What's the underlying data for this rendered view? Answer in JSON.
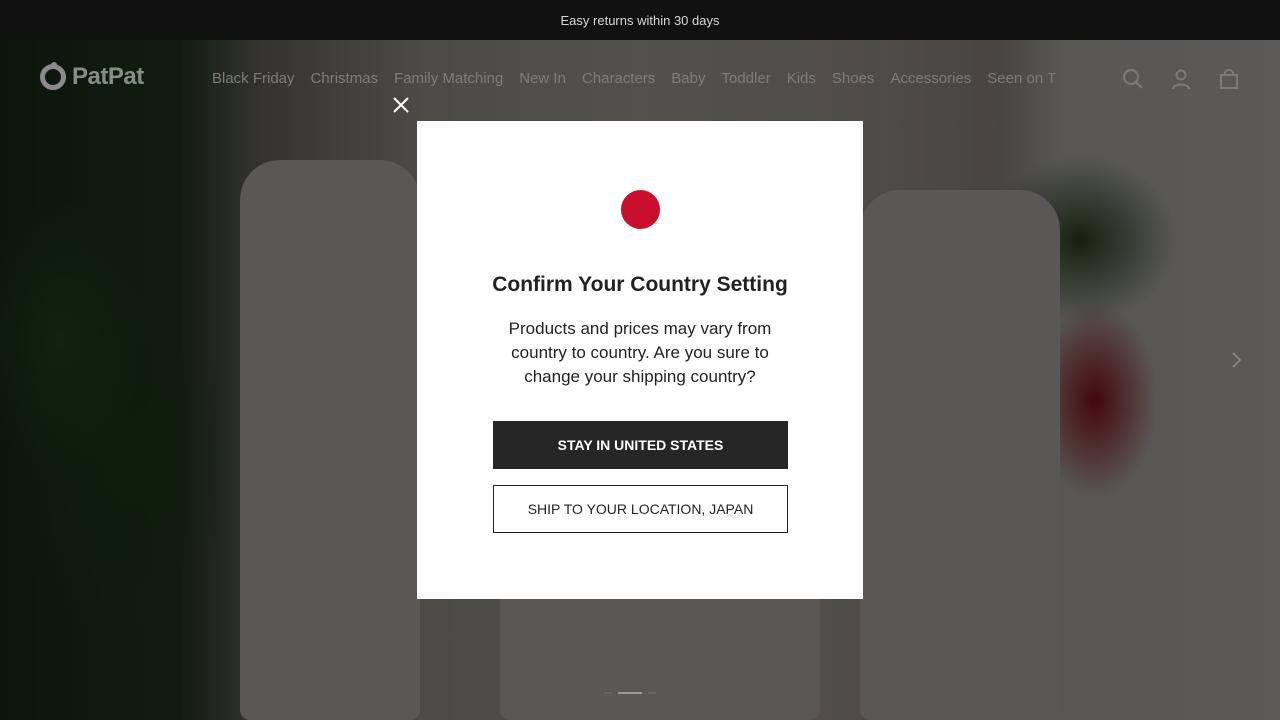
{
  "announcement": "Easy returns within 30 days",
  "brand": {
    "name": "PatPat"
  },
  "nav": {
    "items": [
      "Black Friday",
      "Christmas",
      "Family Matching",
      "New In",
      "Characters",
      "Baby",
      "Toddler",
      "Kids",
      "Shoes",
      "Accessories",
      "Seen on T"
    ],
    "icons": [
      "search-icon",
      "account-icon",
      "bag-icon"
    ]
  },
  "modal": {
    "flag_color": "#c8102e",
    "title": "Confirm Your Country Setting",
    "message": "Products and prices may vary from country to country. Are you sure to change your shipping country?",
    "primary_label": "STAY IN UNITED STATES",
    "secondary_label": "SHIP TO YOUR LOCATION, JAPAN"
  },
  "colors": {
    "topbar": "#111111",
    "primary_button": "#262626"
  }
}
